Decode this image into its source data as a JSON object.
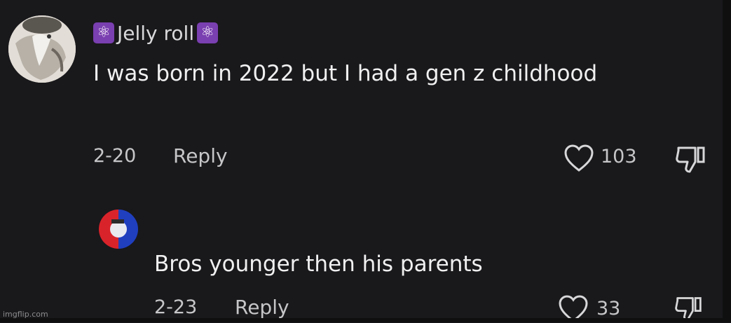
{
  "comments": [
    {
      "username": "Jelly roll",
      "badge_icon": "atom-icon",
      "text": "I was born in 2022 but I had a gen z childhood",
      "date": "2-20",
      "reply_label": "Reply",
      "likes": "103"
    },
    {
      "username": "",
      "text": "Bros younger then his parents",
      "date": "2-23",
      "reply_label": "Reply",
      "likes": "33"
    }
  ],
  "watermark": "imgflip.com",
  "colors": {
    "background": "#19181b",
    "badge": "#7a3fb0",
    "avatar_red": "#d9232a",
    "avatar_blue": "#1f3fbf"
  }
}
